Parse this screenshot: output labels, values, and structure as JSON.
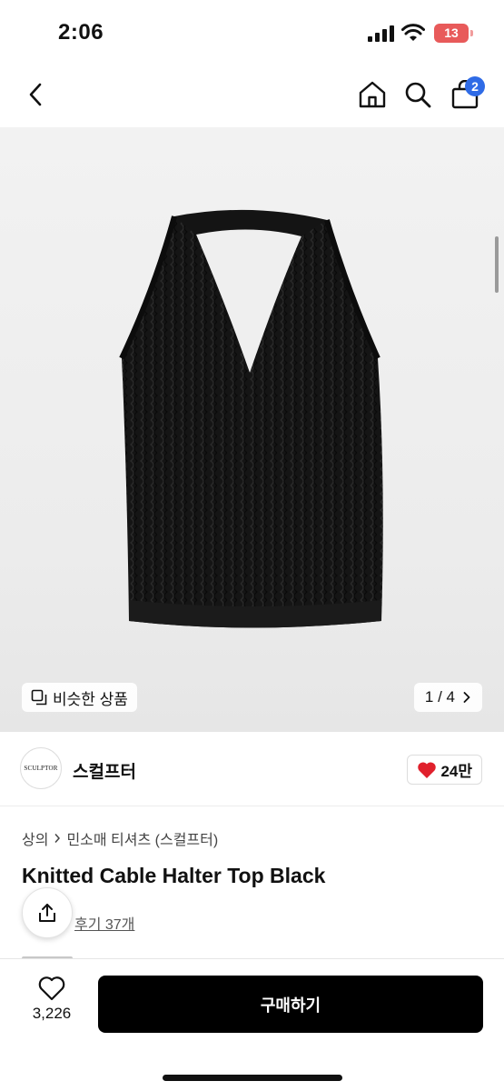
{
  "status_bar": {
    "time": "2:06",
    "battery": "13"
  },
  "nav": {
    "cart_count": "2"
  },
  "gallery": {
    "similar_label": "비슷한 상품",
    "page_indicator": "1 / 4"
  },
  "brand": {
    "logo_text": "SCULPTOR",
    "name": "스컬프터",
    "likes": "24만"
  },
  "breadcrumb": {
    "level1": "상의",
    "level2": "민소매 티셔츠 (스컬프터)"
  },
  "product": {
    "title": "Knitted Cable Halter Top Black",
    "reviews": "후기 37개"
  },
  "bottom_bar": {
    "wish_count": "3,226",
    "buy_label": "구매하기"
  },
  "colors": {
    "accent_blue": "#2f6be6",
    "heart_red": "#e0202c",
    "battery_red": "#e85a5a",
    "button_black": "#000000"
  }
}
